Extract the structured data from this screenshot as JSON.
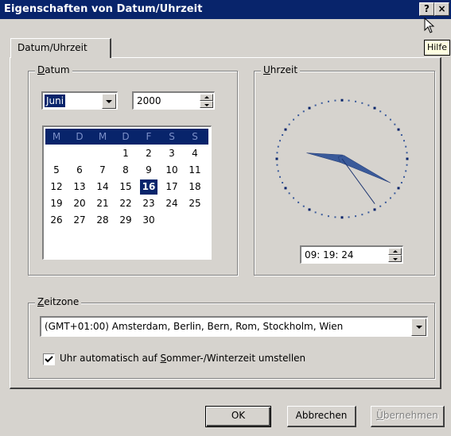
{
  "window": {
    "title": "Eigenschaften von Datum/Uhrzeit",
    "help_button": "?",
    "close_button": "×",
    "tooltip": "Hilfe"
  },
  "tabs": [
    {
      "label": "Datum/Uhrzeit",
      "active": true
    }
  ],
  "date_group": {
    "label_underlined": "D",
    "label_rest": "atum",
    "month": "Juni",
    "year": "2000",
    "weekday_headers": [
      "M",
      "D",
      "M",
      "D",
      "F",
      "S",
      "S"
    ],
    "days": [
      [
        "",
        "",
        "",
        "1",
        "2",
        "3",
        "4"
      ],
      [
        "5",
        "6",
        "7",
        "8",
        "9",
        "10",
        "11"
      ],
      [
        "12",
        "13",
        "14",
        "15",
        "16",
        "17",
        "18"
      ],
      [
        "19",
        "20",
        "21",
        "22",
        "23",
        "24",
        "25"
      ],
      [
        "26",
        "27",
        "28",
        "29",
        "30",
        "",
        ""
      ]
    ],
    "selected_day": "16"
  },
  "time_group": {
    "label_underlined": "U",
    "label_rest": "hrzeit",
    "time": "09: 19: 24",
    "clock": {
      "hour": 9,
      "minute": 19,
      "second": 24
    }
  },
  "timezone_group": {
    "label_underlined": "Z",
    "label_rest": "eitzone",
    "selected": "(GMT+01:00) Amsterdam, Berlin, Bern, Rom, Stockholm, Wien",
    "dst_checkbox_checked": true,
    "dst_label_before": "Uhr automatisch auf ",
    "dst_label_underlined": "S",
    "dst_label_after": "ommer-/Winterzeit umstellen"
  },
  "buttons": {
    "ok": "OK",
    "cancel": "Abbrechen",
    "apply_underlined": "Ü",
    "apply_rest": "bernehmen",
    "apply_enabled": false
  },
  "colors": {
    "titlebar": "#08246b",
    "face": "#d6d3ce",
    "selection": "#08246b",
    "clock_hands": "#3a5a9a"
  },
  "icons": [
    "help-icon",
    "close-icon",
    "cursor-icon",
    "dropdown-arrow-icon",
    "spin-up-icon",
    "spin-down-icon",
    "checkmark-icon"
  ]
}
